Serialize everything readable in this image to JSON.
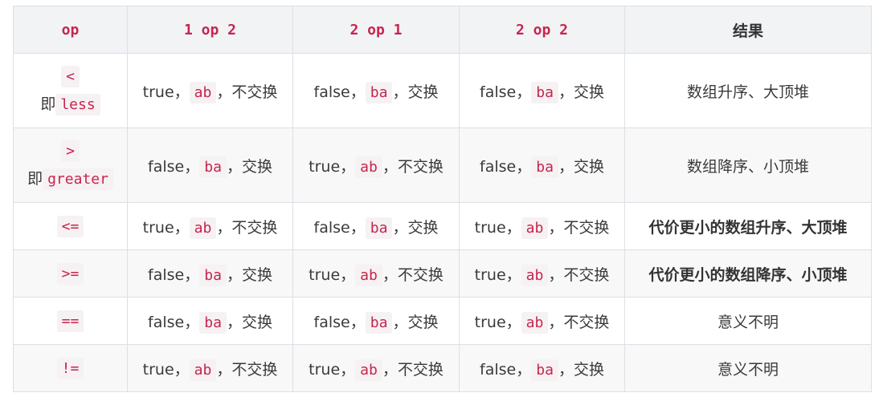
{
  "header": {
    "op": "op",
    "c1": "1 op 2",
    "c2": "2 op 1",
    "c3": "2 op 2",
    "result": "结果"
  },
  "rows": [
    {
      "op": "<",
      "prefix": "即",
      "alias": "less",
      "cells": [
        {
          "bool": "true，",
          "code": "ab",
          "action": "，不交换"
        },
        {
          "bool": "false，",
          "code": "ba",
          "action": "，交换"
        },
        {
          "bool": "false，",
          "code": "ba",
          "action": "，交换"
        }
      ],
      "result": "数组升序、大顶堆",
      "bold": false
    },
    {
      "op": ">",
      "prefix": "即",
      "alias": "greater",
      "cells": [
        {
          "bool": "false，",
          "code": "ba",
          "action": "，交换"
        },
        {
          "bool": "true，",
          "code": "ab",
          "action": "，不交换"
        },
        {
          "bool": "false，",
          "code": "ba",
          "action": "，交换"
        }
      ],
      "result": "数组降序、小顶堆",
      "bold": false
    },
    {
      "op": "<=",
      "cells": [
        {
          "bool": "true，",
          "code": "ab",
          "action": "，不交换"
        },
        {
          "bool": "false，",
          "code": "ba",
          "action": "，交换"
        },
        {
          "bool": "true，",
          "code": "ab",
          "action": "，不交换"
        }
      ],
      "result": "代价更小的数组升序、大顶堆",
      "bold": true
    },
    {
      "op": ">=",
      "cells": [
        {
          "bool": "false，",
          "code": "ba",
          "action": "，交换"
        },
        {
          "bool": "true，",
          "code": "ab",
          "action": "，不交换"
        },
        {
          "bool": "true，",
          "code": "ab",
          "action": "，不交换"
        }
      ],
      "result": "代价更小的数组降序、小顶堆",
      "bold": true
    },
    {
      "op": "==",
      "cells": [
        {
          "bool": "false，",
          "code": "ba",
          "action": "，交换"
        },
        {
          "bool": "false，",
          "code": "ba",
          "action": "，交换"
        },
        {
          "bool": "true，",
          "code": "ab",
          "action": "，不交换"
        }
      ],
      "result": "意义不明",
      "bold": false
    },
    {
      "op": "!=",
      "cells": [
        {
          "bool": "true，",
          "code": "ab",
          "action": "，不交换"
        },
        {
          "bool": "true，",
          "code": "ab",
          "action": "，不交换"
        },
        {
          "bool": "false，",
          "code": "ba",
          "action": "，交换"
        }
      ],
      "result": "意义不明",
      "bold": false
    }
  ]
}
